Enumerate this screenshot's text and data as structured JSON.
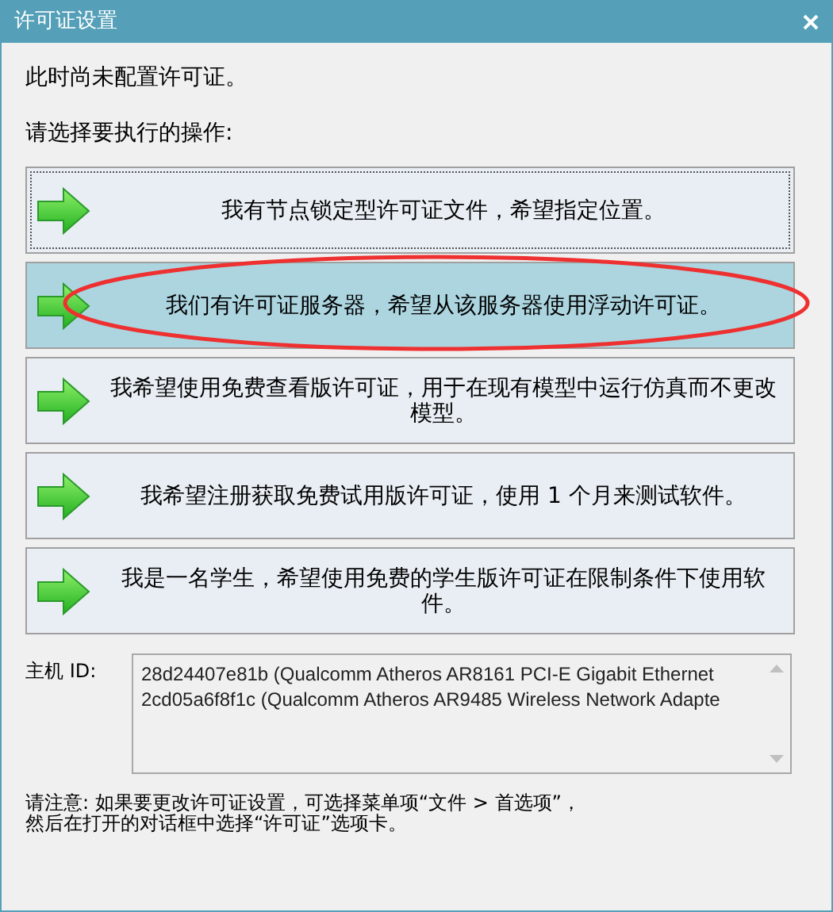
{
  "window": {
    "title": "许可证设置"
  },
  "status_text": "此时尚未配置许可证。",
  "prompt": "请选择要执行的操作:",
  "options": [
    {
      "label": "我有节点锁定型许可证文件，希望指定位置。",
      "focused": true,
      "highlighted": false,
      "annotated": false
    },
    {
      "label": "我们有许可证服务器，希望从该服务器使用浮动许可证。",
      "focused": false,
      "highlighted": true,
      "annotated": true
    },
    {
      "label": "我希望使用免费查看版许可证，用于在现有模型中运行仿真而不更改模型。",
      "focused": false,
      "highlighted": false,
      "annotated": false
    },
    {
      "label": "我希望注册获取免费试用版许可证，使用 1 个月来测试软件。",
      "focused": false,
      "highlighted": false,
      "annotated": false
    },
    {
      "label": "我是一名学生，希望使用免费的学生版许可证在限制条件下使用软件。",
      "focused": false,
      "highlighted": false,
      "annotated": false
    }
  ],
  "host_id": {
    "label": "主机 ID:",
    "entries": [
      "28d24407e81b (Qualcomm Atheros AR8161 PCI-E Gigabit Ethernet",
      "2cd05a6f8f1c (Qualcomm Atheros AR9485 Wireless Network Adapte"
    ]
  },
  "note": [
    "请注意: 如果要更改许可证设置，可选择菜单项“文件 > 首选项”，",
    "然后在打开的对话框中选择“许可证”选项卡。"
  ]
}
